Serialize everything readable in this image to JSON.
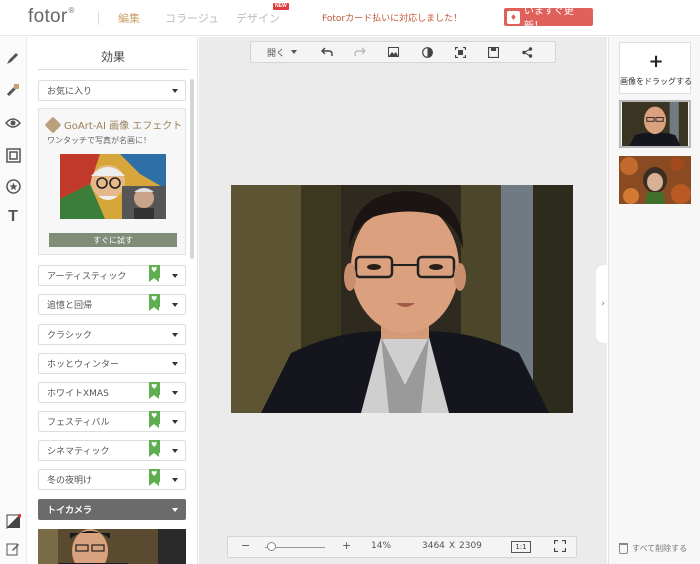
{
  "header": {
    "logo": "fotor",
    "logo_mark": "®",
    "tabs": [
      {
        "label": "編集",
        "active": true
      },
      {
        "label": "コラージュ",
        "active": false
      },
      {
        "label": "デザイン",
        "active": false
      }
    ],
    "new_badge": "NEW",
    "promo": "Fotorカード払いに対応しました！",
    "upgrade_label": "いますぐ更新！"
  },
  "rail": {
    "icons": [
      "brush-icon",
      "magic-wand-icon",
      "eye-icon",
      "frame-icon",
      "sticker-icon",
      "text-icon"
    ],
    "text_icon_glyph": "T"
  },
  "effects": {
    "title": "効果",
    "favorites": "お気に入り",
    "goart": {
      "title": "GoArt-AI 画像 エフェクト",
      "subtitle": "ワンタッチで写真が名画に！",
      "button": "すぐに試す"
    },
    "categories": [
      {
        "label": "アーティスティック",
        "premium": true
      },
      {
        "label": "追憶と回帰",
        "premium": true
      },
      {
        "label": "クラシック",
        "premium": false
      },
      {
        "label": "ホッとウィンター",
        "premium": false
      },
      {
        "label": "ホワイトXMAS",
        "premium": true
      },
      {
        "label": "フェスティバル",
        "premium": true
      },
      {
        "label": "シネマティック",
        "premium": true
      },
      {
        "label": "冬の夜明け",
        "premium": true
      },
      {
        "label": "トイカメラ",
        "premium": false,
        "active": true
      }
    ]
  },
  "toolbar": {
    "open_label": "開く",
    "icons": [
      "undo-icon",
      "redo-icon",
      "image-icon",
      "compare-icon",
      "crop-icon",
      "save-icon",
      "share-icon"
    ]
  },
  "zoom": {
    "minus": "−",
    "plus": "+",
    "percent": "14%",
    "level": 0.14,
    "width": "3464",
    "times": "X",
    "height": "2309",
    "ratio_label": "1:1"
  },
  "right_panel": {
    "add_plus": "+",
    "add_label": "画像をドラッグする",
    "delete_all": "すべて削除する"
  },
  "colors": {
    "accent_gold": "#c9a06a",
    "upgrade_red": "#e0605c",
    "premium_green": "#5fae4f",
    "promo_orange": "#c0563b"
  }
}
